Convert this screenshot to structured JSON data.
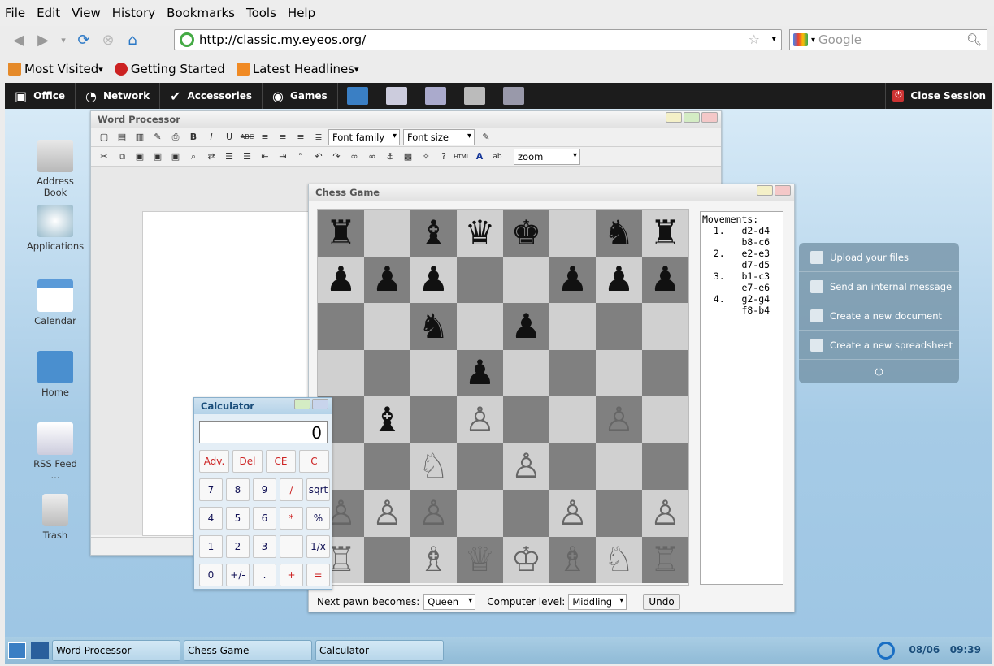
{
  "browser": {
    "menu": [
      "File",
      "Edit",
      "View",
      "History",
      "Bookmarks",
      "Tools",
      "Help"
    ],
    "url": "http://classic.my.eyeos.org/",
    "search_placeholder": "Google",
    "bookmarks": [
      "Most Visited",
      "Getting Started",
      "Latest Headlines"
    ]
  },
  "top_taskbar": {
    "items": [
      "Office",
      "Network",
      "Accessories",
      "Games"
    ],
    "close_session": "Close Session"
  },
  "desktop": {
    "icons": [
      "Address Book",
      "Applications",
      "Calendar",
      "Home",
      "RSS Feed ...",
      "Trash"
    ]
  },
  "word_processor": {
    "title": "Word Processor",
    "font_family": "Font family",
    "font_size": "Font size",
    "zoom": "zoom"
  },
  "chess": {
    "title": "Chess Game",
    "board": [
      [
        "♜",
        "",
        "♝",
        "♛",
        "♚",
        "",
        "♞",
        "♜"
      ],
      [
        "♟",
        "♟",
        "♟",
        "",
        "",
        "♟",
        "♟",
        "♟"
      ],
      [
        "",
        "",
        "♞",
        "",
        "♟",
        "",
        "",
        ""
      ],
      [
        "",
        "",
        "",
        "♟",
        "",
        "",
        "",
        ""
      ],
      [
        "",
        "♝",
        "",
        "♙",
        "",
        "",
        "♙",
        ""
      ],
      [
        "",
        "",
        "♘",
        "",
        "♙",
        "",
        "",
        ""
      ],
      [
        "♙",
        "♙",
        "♙",
        "",
        "",
        "♙",
        "",
        "♙"
      ],
      [
        "♖",
        "",
        "♗",
        "♕",
        "♔",
        "♗",
        "♘",
        "♖"
      ]
    ],
    "movements_label": "Movements:",
    "moves": [
      "  1.   d2-d4",
      "       b8-c6",
      "  2.   e2-e3",
      "       d7-d5",
      "  3.   b1-c3",
      "       e7-e6",
      "  4.   g2-g4",
      "       f8-b4"
    ],
    "pawn_label": "Next pawn becomes:",
    "pawn_value": "Queen",
    "level_label": "Computer level:",
    "level_value": "Middling",
    "undo": "Undo"
  },
  "calculator": {
    "title": "Calculator",
    "display": "0",
    "rows": [
      [
        "Adv.",
        "Del",
        "CE",
        "C"
      ],
      [
        "7",
        "8",
        "9",
        "/",
        "sqrt"
      ],
      [
        "4",
        "5",
        "6",
        "*",
        "%"
      ],
      [
        "1",
        "2",
        "3",
        "-",
        "1/x"
      ],
      [
        "0",
        "+/-",
        ".",
        "+",
        "="
      ]
    ]
  },
  "panel": {
    "items": [
      "Upload your files",
      "Send an internal message",
      "Create a new document",
      "Create a new spreadsheet"
    ]
  },
  "bottom_taskbar": {
    "tasks": [
      "Word Processor",
      "Chess Game",
      "Calculator"
    ],
    "date": "08/06",
    "time": "09:39"
  },
  "colors": {
    "dark_bar": "#1c1c1c",
    "board_dark": "#808080",
    "board_light": "#d0d0d0"
  }
}
